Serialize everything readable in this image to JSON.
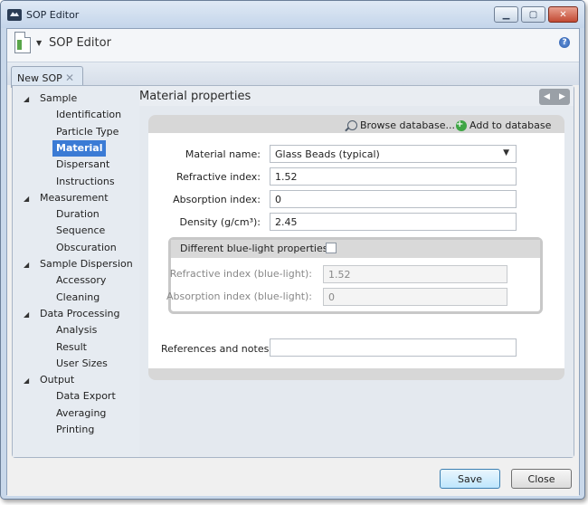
{
  "window": {
    "title": "SOP Editor"
  },
  "app": {
    "title": "SOP Editor",
    "help_glyph": "?"
  },
  "tabs": [
    {
      "label": "New SOP",
      "close_glyph": "✕"
    }
  ],
  "tree": [
    {
      "label": "Sample",
      "children": [
        "Identification",
        "Particle Type",
        "Material",
        "Dispersant",
        "Instructions"
      ]
    },
    {
      "label": "Measurement",
      "children": [
        "Duration",
        "Sequence",
        "Obscuration"
      ]
    },
    {
      "label": "Sample Dispersion",
      "children": [
        "Accessory",
        "Cleaning"
      ]
    },
    {
      "label": "Data Processing",
      "children": [
        "Analysis",
        "Result",
        "User Sizes"
      ]
    },
    {
      "label": "Output",
      "children": [
        "Data Export",
        "Averaging",
        "Printing"
      ]
    }
  ],
  "tree_selected": "Material",
  "section": {
    "title": "Material properties"
  },
  "toolbar": {
    "browse_label": "Browse database...",
    "add_label": "Add to database"
  },
  "form": {
    "material_name": {
      "label": "Material name:",
      "value": "Glass Beads (typical)"
    },
    "refractive_index": {
      "label": "Refractive index:",
      "value": "1.52"
    },
    "absorption_index": {
      "label": "Absorption index:",
      "value": "0"
    },
    "density": {
      "label": "Density (g/cm³):",
      "value": "2.45"
    },
    "blue_light": {
      "label": "Different blue-light properties:",
      "checked": false,
      "refractive": {
        "label": "Refractive index (blue-light):",
        "value": "1.52"
      },
      "absorption": {
        "label": "Absorption index (blue-light):",
        "value": "0"
      }
    },
    "references": {
      "label": "References and notes:",
      "value": ""
    }
  },
  "buttons": {
    "save": "Save",
    "close": "Close"
  },
  "colors": {
    "selection": "#3b7bd5",
    "close_button": "#c24a33",
    "add_icon": "#3ea544"
  }
}
